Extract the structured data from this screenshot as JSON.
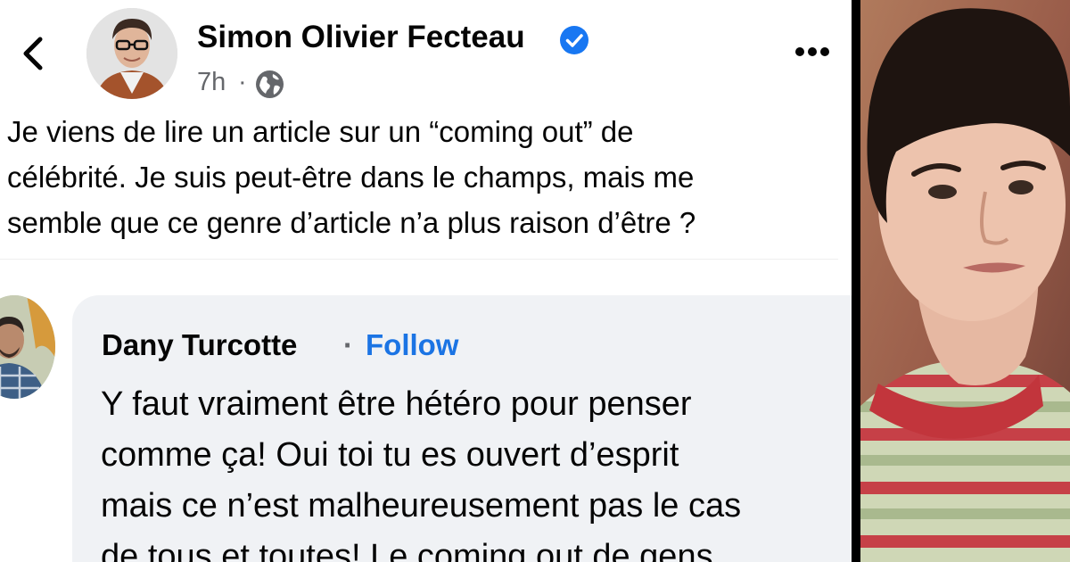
{
  "post": {
    "author_name": "Simon Olivier Fecteau",
    "time": "7h",
    "time_separator": "·",
    "text_lines": [
      "Je viens de lire un article sur un “coming out” de",
      "célébrité. Je suis peut-être dans le champs, mais me",
      "semble que ce genre d’article n’a plus raison d’être ?"
    ],
    "icons": {
      "back": "chevron-left-icon",
      "verified": "verified-badge-icon",
      "privacy": "globe-icon",
      "more": "more-options-icon"
    }
  },
  "comment": {
    "author_name": "Dany Turcotte",
    "follow_separator": "·",
    "follow_label": "Follow",
    "text_lines": [
      "Y faut vraiment être hétéro pour penser",
      "comme ça! Oui toi tu es ouvert d’esprit",
      "mais ce n’est malheureusement pas le cas",
      "de tous et toutes! Le coming out de gens"
    ]
  },
  "colors": {
    "link_blue": "#1b74e4",
    "verified_blue": "#1877f2",
    "secondary_text": "#65676b",
    "comment_bubble": "#f0f2f5"
  }
}
